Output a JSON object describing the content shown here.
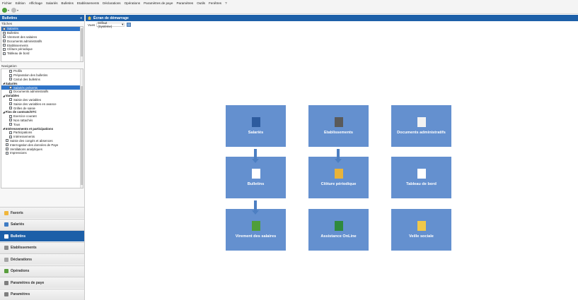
{
  "menubar": [
    "Fichier",
    "Edition",
    "Affichage",
    "Salariés",
    "Bulletins",
    "Etablissements",
    "Déclarations",
    "Opérations",
    "Paramètres de paye",
    "Paramètres",
    "Outils",
    "Fenêtres",
    "?"
  ],
  "left_panel": {
    "title": "Bulletins",
    "collapse": "«",
    "tasks_label": "Tâches",
    "tasks": [
      {
        "label": "Salariés",
        "selected": true
      },
      {
        "label": "Bulletins",
        "selected": false
      },
      {
        "label": "Virement des salaires",
        "selected": false
      },
      {
        "label": "Documents administratifs",
        "selected": false
      },
      {
        "label": "Etablissements",
        "selected": false
      },
      {
        "label": "Clôture périodique",
        "selected": false
      },
      {
        "label": "Tableau de bord",
        "selected": false
      }
    ],
    "nav_label": "Navigation",
    "nav": [
      {
        "label": "Profils",
        "kind": "l2"
      },
      {
        "label": "Préparation des bulletins",
        "kind": "l2"
      },
      {
        "label": "Calcul des bulletins",
        "kind": "l2"
      },
      {
        "label": "Salariés",
        "kind": "grp"
      },
      {
        "label": "Salariés présents",
        "kind": "l2",
        "selected": true
      },
      {
        "label": "Documents administratifs",
        "kind": "l2"
      },
      {
        "label": "Variables",
        "kind": "grp"
      },
      {
        "label": "Saisie des variables",
        "kind": "l2"
      },
      {
        "label": "Saisie des variables en avance",
        "kind": "l2"
      },
      {
        "label": "Grilles de saisie",
        "kind": "l2"
      },
      {
        "label": "Fins de contrats/STC",
        "kind": "grp"
      },
      {
        "label": "Exercice courant",
        "kind": "l2"
      },
      {
        "label": "Non rattachés",
        "kind": "l2"
      },
      {
        "label": "Tous",
        "kind": "l2"
      },
      {
        "label": "Intéressements et participations",
        "kind": "grp"
      },
      {
        "label": "Participations",
        "kind": "l2"
      },
      {
        "label": "Intéressements",
        "kind": "l2"
      },
      {
        "label": "Saisie des congés et absences",
        "kind": "l1"
      },
      {
        "label": "Interrogation des données de Paye",
        "kind": "l1"
      },
      {
        "label": "Ventilations analytiques",
        "kind": "l1"
      },
      {
        "label": "Impressions",
        "kind": "l1"
      }
    ],
    "accordion": [
      {
        "label": "Favoris",
        "color": "#f0b63c",
        "active": false
      },
      {
        "label": "Salariés",
        "color": "#3f7cc4",
        "active": false
      },
      {
        "label": "Bulletins",
        "color": "#ffffff",
        "active": true
      },
      {
        "label": "Etablissements",
        "color": "#8a8a8a",
        "active": false
      },
      {
        "label": "Déclarations",
        "color": "#a6a6a6",
        "active": false
      },
      {
        "label": "Opérations",
        "color": "#5a9e3e",
        "active": false
      },
      {
        "label": "Paramètres de paye",
        "color": "#7f7f7f",
        "active": false
      },
      {
        "label": "Paramètres",
        "color": "#7f7f7f",
        "active": false
      }
    ]
  },
  "main": {
    "title": "Écran de démarrage",
    "vue_label": "Vues",
    "vue_value": "Défaut (Système)",
    "tiles": [
      {
        "label": "Salariés",
        "icon": "person-icon"
      },
      {
        "label": "Etablissements",
        "icon": "building-icon"
      },
      {
        "label": "Documents administratifs",
        "icon": "document-icon"
      },
      {
        "label": "Bulletins",
        "icon": "payslip-icon"
      },
      {
        "label": "Clôture périodique",
        "icon": "lock-icon"
      },
      {
        "label": "Tableau de bord",
        "icon": "dashboard-icon"
      },
      {
        "label": "Virement des salaires",
        "icon": "money-icon"
      },
      {
        "label": "Assistance OnLine",
        "icon": "support-icon"
      },
      {
        "label": "Veille sociale",
        "icon": "wand-icon"
      }
    ]
  },
  "colors": {
    "accent": "#1c5fa8",
    "tile": "#6490cf",
    "arrow": "#4d7fc2"
  }
}
